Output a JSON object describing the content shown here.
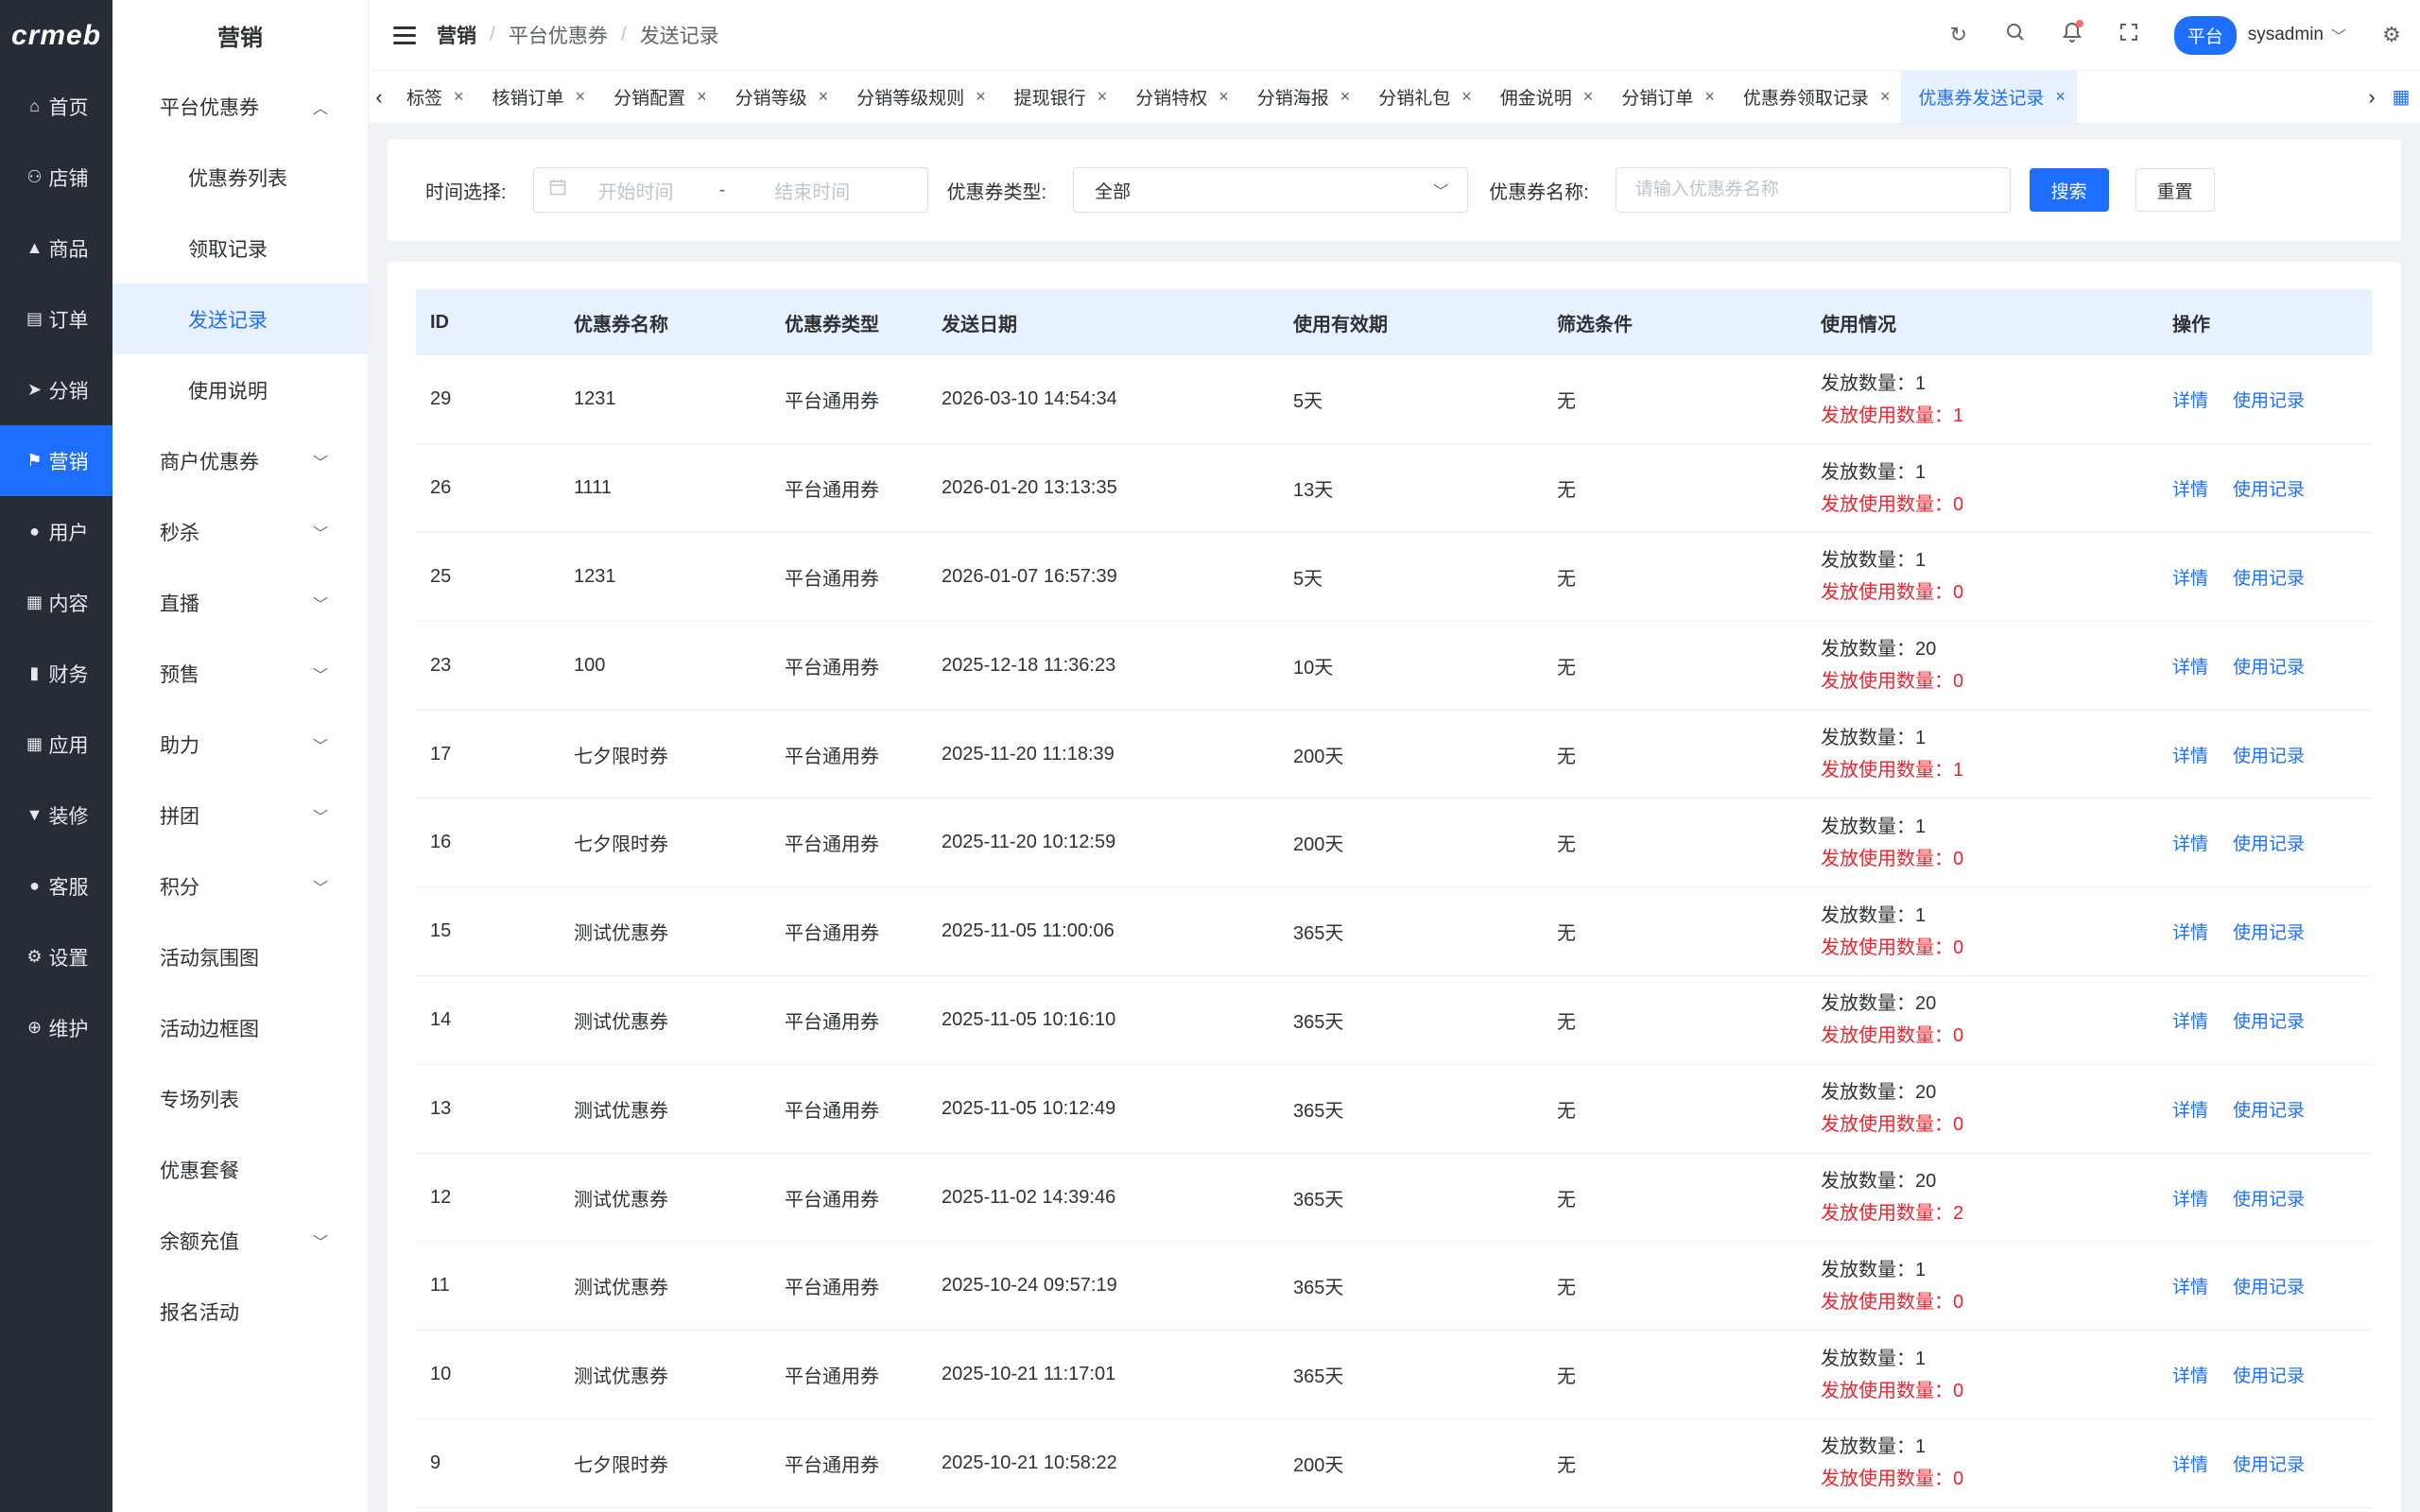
{
  "logo": "crmeb",
  "rail": [
    {
      "icon": "home-icon",
      "glyph": "⌂",
      "label": "首页"
    },
    {
      "icon": "store-icon",
      "glyph": "⚇",
      "label": "店铺"
    },
    {
      "icon": "goods-icon",
      "glyph": "▲",
      "label": "商品"
    },
    {
      "icon": "order-icon",
      "glyph": "▤",
      "label": "订单"
    },
    {
      "icon": "distribution-icon",
      "glyph": "➤",
      "label": "分销"
    },
    {
      "icon": "marketing-flag-icon",
      "glyph": "⚑",
      "label": "营销"
    },
    {
      "icon": "user-icon",
      "glyph": "●",
      "label": "用户"
    },
    {
      "icon": "content-icon",
      "glyph": "▦",
      "label": "内容"
    },
    {
      "icon": "finance-icon",
      "glyph": "▮",
      "label": "财务"
    },
    {
      "icon": "apps-icon",
      "glyph": "▦",
      "label": "应用"
    },
    {
      "icon": "decorate-icon",
      "glyph": "▼",
      "label": "装修"
    },
    {
      "icon": "service-icon",
      "glyph": "●",
      "label": "客服"
    },
    {
      "icon": "settings-icon",
      "glyph": "⚙",
      "label": "设置"
    },
    {
      "icon": "maintain-icon",
      "glyph": "⊕",
      "label": "维护"
    }
  ],
  "submenu": {
    "title": "营销",
    "group_open": "平台优惠券",
    "children": [
      "优惠券列表",
      "领取记录",
      "发送记录",
      "使用说明"
    ],
    "groups": [
      "商户优惠券",
      "秒杀",
      "直播",
      "预售",
      "助力",
      "拼团",
      "积分"
    ],
    "plain1": [
      "活动氛围图",
      "活动边框图",
      "专场列表",
      "优惠套餐"
    ],
    "group_balance": "余额充值",
    "plain2": [
      "报名活动"
    ]
  },
  "header": {
    "crumbs": [
      "营销",
      "平台优惠券",
      "发送记录"
    ],
    "platform": "平台",
    "username": "sysadmin"
  },
  "tabs": [
    "标签",
    "核销订单",
    "分销配置",
    "分销等级",
    "分销等级规则",
    "提现银行",
    "分销特权",
    "分销海报",
    "分销礼包",
    "佣金说明",
    "分销订单",
    "优惠券领取记录",
    "优惠券发送记录"
  ],
  "filter": {
    "time_label": "时间选择:",
    "start_placeholder": "开始时间",
    "dash": "-",
    "end_placeholder": "结束时间",
    "type_label": "优惠券类型:",
    "type_value": "全部",
    "name_label": "优惠券名称:",
    "name_placeholder": "请输入优惠券名称",
    "search": "搜索",
    "reset": "重置"
  },
  "table": {
    "headers": [
      "ID",
      "优惠券名称",
      "优惠券类型",
      "发送日期",
      "使用有效期",
      "筛选条件",
      "使用情况",
      "操作"
    ],
    "issued_label": "发放数量：",
    "used_label": "发放使用数量：",
    "op_detail": "详情",
    "op_record": "使用记录",
    "rows": [
      {
        "id": "29",
        "name": "1231",
        "type": "平台通用券",
        "date": "2026-03-10 14:54:34",
        "valid": "5天",
        "cond": "无",
        "issued": "1",
        "used": "1"
      },
      {
        "id": "26",
        "name": "1111",
        "type": "平台通用券",
        "date": "2026-01-20 13:13:35",
        "valid": "13天",
        "cond": "无",
        "issued": "1",
        "used": "0"
      },
      {
        "id": "25",
        "name": "1231",
        "type": "平台通用券",
        "date": "2026-01-07 16:57:39",
        "valid": "5天",
        "cond": "无",
        "issued": "1",
        "used": "0"
      },
      {
        "id": "23",
        "name": "100",
        "type": "平台通用券",
        "date": "2025-12-18 11:36:23",
        "valid": "10天",
        "cond": "无",
        "issued": "20",
        "used": "0"
      },
      {
        "id": "17",
        "name": "七夕限时券",
        "type": "平台通用券",
        "date": "2025-11-20 11:18:39",
        "valid": "200天",
        "cond": "无",
        "issued": "1",
        "used": "1"
      },
      {
        "id": "16",
        "name": "七夕限时券",
        "type": "平台通用券",
        "date": "2025-11-20 10:12:59",
        "valid": "200天",
        "cond": "无",
        "issued": "1",
        "used": "0"
      },
      {
        "id": "15",
        "name": "测试优惠券",
        "type": "平台通用券",
        "date": "2025-11-05 11:00:06",
        "valid": "365天",
        "cond": "无",
        "issued": "1",
        "used": "0"
      },
      {
        "id": "14",
        "name": "测试优惠券",
        "type": "平台通用券",
        "date": "2025-11-05 10:16:10",
        "valid": "365天",
        "cond": "无",
        "issued": "20",
        "used": "0"
      },
      {
        "id": "13",
        "name": "测试优惠券",
        "type": "平台通用券",
        "date": "2025-11-05 10:12:49",
        "valid": "365天",
        "cond": "无",
        "issued": "20",
        "used": "0"
      },
      {
        "id": "12",
        "name": "测试优惠券",
        "type": "平台通用券",
        "date": "2025-11-02 14:39:46",
        "valid": "365天",
        "cond": "无",
        "issued": "20",
        "used": "2"
      },
      {
        "id": "11",
        "name": "测试优惠券",
        "type": "平台通用券",
        "date": "2025-10-24 09:57:19",
        "valid": "365天",
        "cond": "无",
        "issued": "1",
        "used": "0"
      },
      {
        "id": "10",
        "name": "测试优惠券",
        "type": "平台通用券",
        "date": "2025-10-21 11:17:01",
        "valid": "365天",
        "cond": "无",
        "issued": "1",
        "used": "0"
      },
      {
        "id": "9",
        "name": "七夕限时券",
        "type": "平台通用券",
        "date": "2025-10-21 10:58:22",
        "valid": "200天",
        "cond": "无",
        "issued": "1",
        "used": "0"
      }
    ]
  }
}
